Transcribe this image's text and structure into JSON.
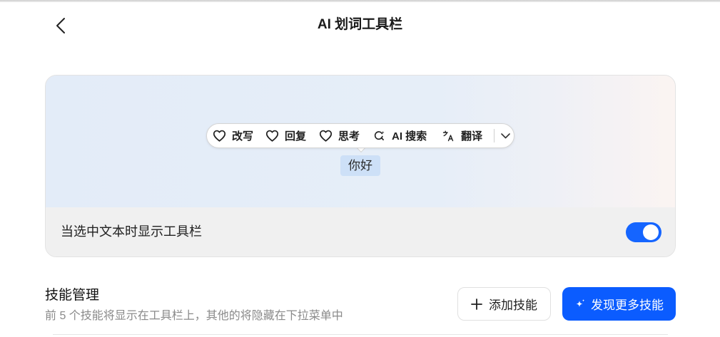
{
  "header": {
    "title": "AI 划词工具栏",
    "back_icon": "chevron-left-icon"
  },
  "preview": {
    "toolbar_items": [
      {
        "icon": "heart-icon",
        "label": "改写"
      },
      {
        "icon": "heart-icon",
        "label": "回复"
      },
      {
        "icon": "heart-icon",
        "label": "思考"
      },
      {
        "icon": "ai-search-icon",
        "label": "AI 搜索"
      },
      {
        "icon": "translate-icon",
        "label": "翻译"
      }
    ],
    "more_icon": "chevron-down-icon",
    "selected_text": "你好"
  },
  "setting": {
    "label": "当选中文本时显示工具栏",
    "toggle_on": true
  },
  "skills": {
    "title": "技能管理",
    "subtitle": "前 5 个技能将显示在工具栏上，其他的将隐藏在下拉菜单中",
    "add_button": {
      "icon": "plus-icon",
      "label": "添加技能"
    },
    "discover_button": {
      "icon": "sparkle-icon",
      "label": "发现更多技能"
    }
  },
  "colors": {
    "accent": "#0b5cff",
    "toggle_on": "#1565ff",
    "selection_highlight": "#cde0f7",
    "text_primary": "#1f1f1f",
    "text_secondary": "#8a8a8a"
  }
}
